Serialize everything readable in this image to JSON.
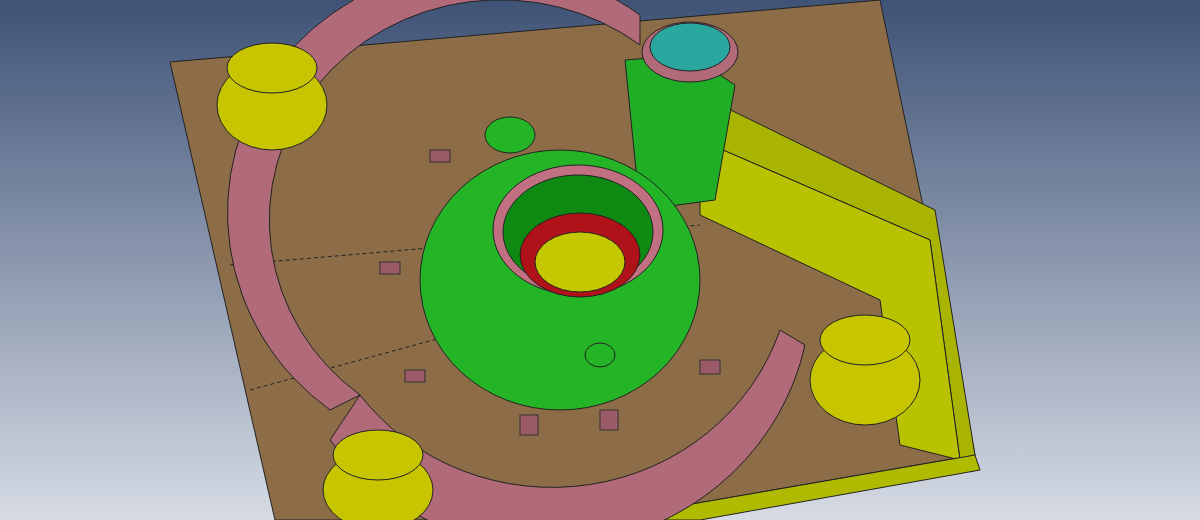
{
  "viewport": {
    "kind": "cad-render"
  }
}
